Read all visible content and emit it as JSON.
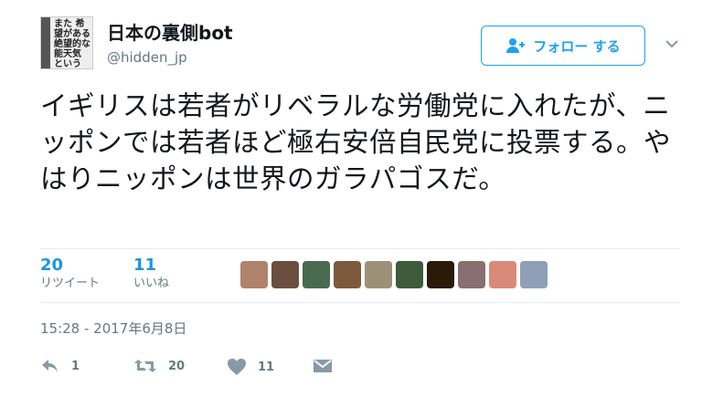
{
  "account": {
    "name": "日本の裏側bot",
    "handle": "@hidden_jp",
    "avatar_text": "また 希望がある 絶望的な 能天気 という"
  },
  "follow_button": {
    "label": "フォロー する",
    "icon": "add-user-icon"
  },
  "menu_caret": {
    "icon": "chevron-down-icon"
  },
  "tweet": {
    "text": "イギリスは若者がリベラルな労働党に入れたが、ニッポンでは若者ほど極右安倍自民党に投票する。やはりニッポンは世界のガラパゴスだ。",
    "timestamp": "15:28 - 2017年6月8日"
  },
  "stats": {
    "retweets": {
      "count": "20",
      "label": "リツイート"
    },
    "likes": {
      "count": "11",
      "label": "いいね"
    }
  },
  "likers": [
    "#b0826a",
    "#6b4f3e",
    "#4a6a4f",
    "#7d5a3c",
    "#9c9178",
    "#3d5a3a",
    "#2a1a08",
    "#8a6f70",
    "#d98a7a",
    "#8f9fb5"
  ],
  "actions": {
    "reply": {
      "count": "1",
      "icon": "reply-icon"
    },
    "retweet": {
      "count": "20",
      "icon": "retweet-icon"
    },
    "like": {
      "count": "11",
      "icon": "heart-icon"
    },
    "dm": {
      "icon": "envelope-icon"
    }
  },
  "colors": {
    "accent": "#1da1f2",
    "muted": "#657786",
    "text": "#14171a"
  }
}
